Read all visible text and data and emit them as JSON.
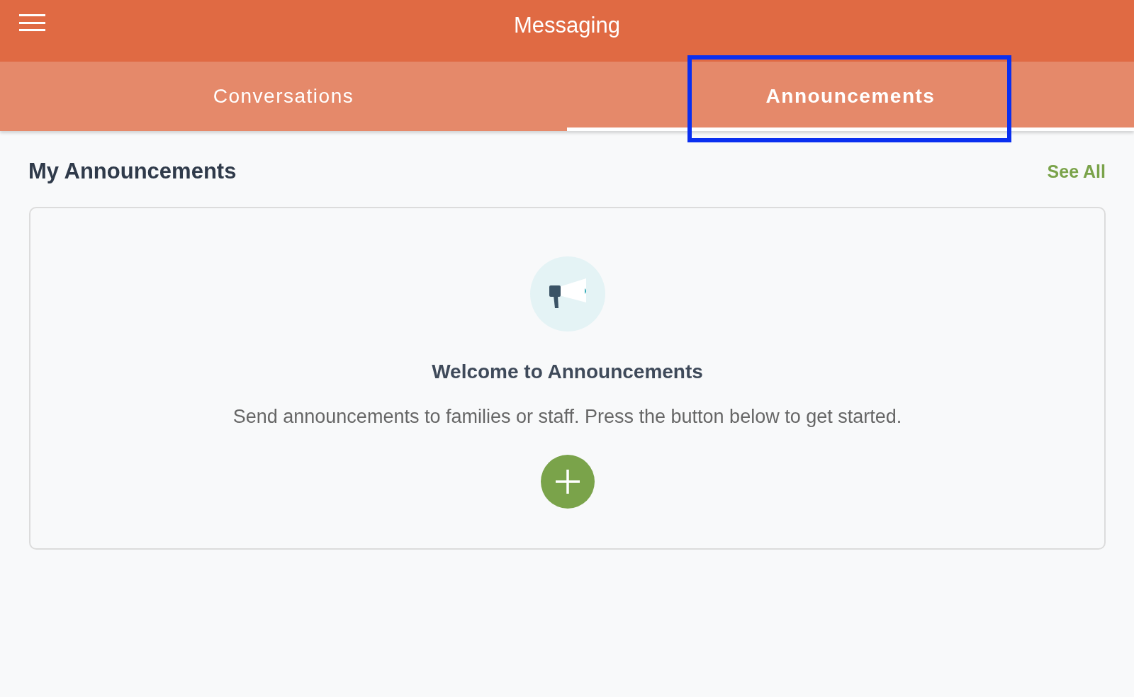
{
  "header": {
    "title": "Messaging"
  },
  "tabs": [
    {
      "label": "Conversations",
      "selected": false
    },
    {
      "label": "Announcements",
      "selected": true,
      "highlighted": true
    }
  ],
  "section": {
    "title": "My Announcements",
    "link": "See All"
  },
  "empty_state": {
    "title": "Welcome to Announcements",
    "description": "Send announcements to families or staff. Press the button below to get started."
  }
}
